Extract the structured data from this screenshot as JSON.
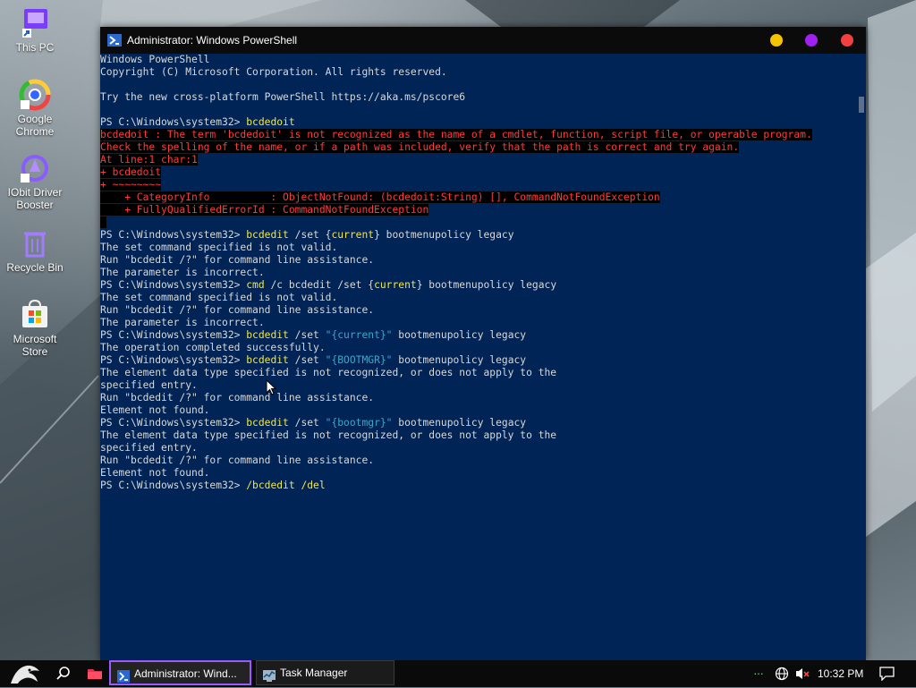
{
  "desktop": {
    "icons": [
      {
        "label": "This PC",
        "icon": "this-pc-icon"
      },
      {
        "label": "Google Chrome",
        "icon": "chrome-icon"
      },
      {
        "label": "IObit Driver Booster",
        "icon": "driver-booster-icon"
      },
      {
        "label": "Recycle Bin",
        "icon": "recycle-bin-icon"
      },
      {
        "label": "Microsoft Store",
        "icon": "microsoft-store-icon"
      }
    ]
  },
  "window": {
    "title": "Administrator: Windows PowerShell",
    "controls": {
      "minimize_color": "#f5c400",
      "maximize_color": "#a020f0",
      "close_color": "#f04040"
    }
  },
  "console": {
    "prompt": "PS C:\\Windows\\system32> ",
    "intro": [
      "Windows PowerShell",
      "Copyright (C) Microsoft Corporation. All rights reserved.",
      "",
      "Try the new cross-platform PowerShell https://aka.ms/pscore6",
      ""
    ],
    "cmd1": "bcdedoit",
    "error_lines": [
      "bcdedoit : The term 'bcdedoit' is not recognized as the name of a cmdlet, function, script file, or operable program.",
      "Check the spelling of the name, or if a path was included, verify that the path is correct and try again.",
      "At line:1 char:1",
      "+ bcdedoit",
      "+ ~~~~~~~~",
      "    + CategoryInfo          : ObjectNotFound: (bcdedoit:String) [], CommandNotFoundException",
      "    + FullyQualifiedErrorId : CommandNotFoundException"
    ],
    "cmd2": {
      "exe": "bcdedit",
      "a": " /set {",
      "pv": "current",
      "b": "} bootmenupolicy legacy"
    },
    "out2": [
      "The set command specified is not valid.",
      "Run \"bcdedit /?\" for command line assistance.",
      "The parameter is incorrect."
    ],
    "cmd3": {
      "exe": "cmd",
      "a": " /c bcdedit /set {",
      "pv": "current",
      "b": "} bootmenupolicy legacy"
    },
    "out3": [
      "The set command specified is not valid.",
      "Run \"bcdedit /?\" for command line assistance.",
      "The parameter is incorrect."
    ],
    "cmd4": {
      "exe": "bcdedit",
      "a": " /set ",
      "str": "\"{current}\"",
      "b": " bootmenupolicy legacy"
    },
    "out4": [
      "The operation completed successfully."
    ],
    "cmd5": {
      "exe": "bcdedit",
      "a": " /set ",
      "str": "\"{BOOTMGR}\"",
      "b": " bootmenupolicy legacy"
    },
    "out5": [
      "The element data type specified is not recognized, or does not apply to the",
      "specified entry.",
      "Run \"bcdedit /?\" for command line assistance.",
      "Element not found."
    ],
    "cmd6": {
      "exe": "bcdedit",
      "a": " /set ",
      "str": "\"{bootmgr}\"",
      "b": " bootmenupolicy legacy"
    },
    "out6": [
      "The element data type specified is not recognized, or does not apply to the",
      "specified entry.",
      "Run \"bcdedit /?\" for command line assistance.",
      "Element not found."
    ],
    "current_input": "/bcdedit /del"
  },
  "taskbar": {
    "start_icon": "dragon-logo-icon",
    "search_icon": "search-icon",
    "explorer_icon": "folder-icon",
    "buttons": [
      {
        "label": "Administrator: Wind...",
        "icon": "powershell-icon",
        "active": true
      },
      {
        "label": "Task Manager",
        "icon": "task-manager-icon",
        "active": false
      }
    ],
    "tray": {
      "overflow": "···",
      "time": "10:32 PM"
    }
  }
}
